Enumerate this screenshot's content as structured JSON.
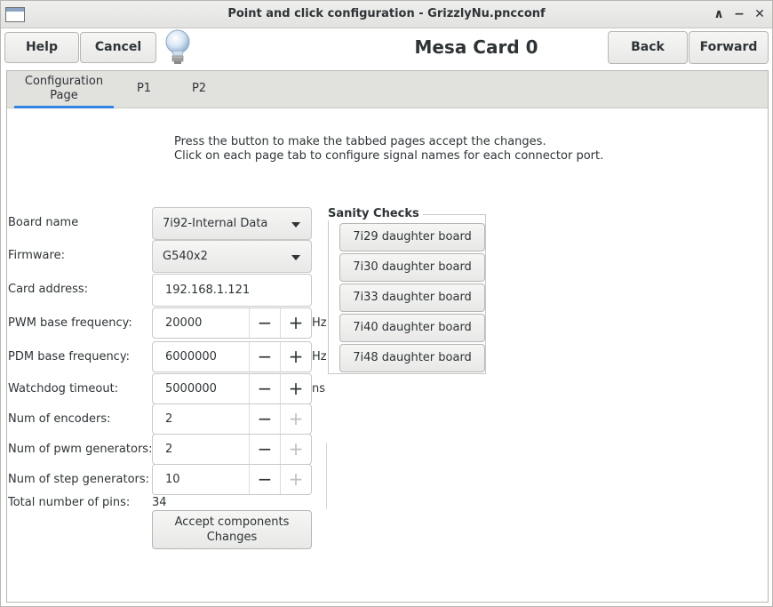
{
  "window": {
    "title": "Point and click configuration - GrizzlyNu.pncconf",
    "controls": {
      "minimize": "−",
      "maximize": "∧",
      "close": "✕"
    }
  },
  "header": {
    "help_label": "Help",
    "cancel_label": "Cancel",
    "title": "Mesa Card 0",
    "back_label": "Back",
    "forward_label": "Forward",
    "hint_icon": "lightbulb-icon"
  },
  "tabs": [
    {
      "label_line1": "Configuration",
      "label_line2": "Page",
      "active": true
    },
    {
      "label": "P1",
      "active": false
    },
    {
      "label": "P2",
      "active": false
    }
  ],
  "info": {
    "line1": "Press the button to make the tabbed pages accept the changes.",
    "line2": "Click on each page tab to configure signal names for each connector port."
  },
  "form": {
    "board_name": {
      "label": "Board name",
      "value": "7i92-Internal Data"
    },
    "firmware": {
      "label": "Firmware:",
      "value": "G540x2"
    },
    "card_address": {
      "label": "Card address:",
      "value": "192.168.1.121"
    },
    "pwm_base_frequency": {
      "label": "PWM base frequency:",
      "value": "20000",
      "unit": "Hz"
    },
    "pdm_base_frequency": {
      "label": "PDM base frequency:",
      "value": "6000000",
      "unit": "Hz"
    },
    "watchdog_timeout": {
      "label": "Watchdog timeout:",
      "value": "5000000",
      "unit": "ns"
    },
    "num_encoders": {
      "label": "Num of encoders:",
      "value": "2"
    },
    "num_pwm_generators": {
      "label": "Num of pwm generators:",
      "value": "2"
    },
    "num_step_generators": {
      "label": "Num of step generators:",
      "value": "10"
    },
    "total_pins": {
      "label": "Total number of pins:",
      "value": "34"
    },
    "spin_minus": "−",
    "spin_plus": "+"
  },
  "accept": {
    "line1": "Accept  components",
    "line2": "Changes"
  },
  "sanity_checks": {
    "title": "Sanity Checks",
    "buttons": [
      "7i29 daughter board",
      "7i30 daughter board",
      "7i33 daughter board",
      "7i40 daughter board",
      "7i48 daughter board"
    ]
  },
  "colors": {
    "accent": "#3584e4",
    "tabbar_bg": "#e1e1de",
    "text": "#2e3436"
  }
}
